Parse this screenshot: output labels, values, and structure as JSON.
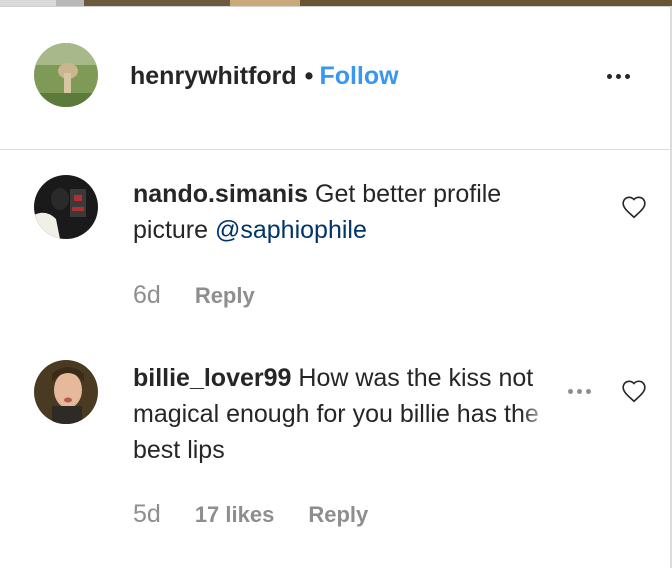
{
  "post_author": {
    "username": "henrywhitford",
    "separator": "•",
    "follow_label": "Follow"
  },
  "comments": [
    {
      "username": "nando.simanis",
      "text": "Get better profile picture",
      "mention": "@saphiophile",
      "time": "6d",
      "reply_label": "Reply"
    },
    {
      "username": "billie_lover99",
      "text": "How was the kiss not magical enough for you billie has the best lips",
      "time": "5d",
      "likes": "17 likes",
      "reply_label": "Reply"
    }
  ],
  "icons": {
    "more": "more-options-icon",
    "like": "heart-outline-icon"
  },
  "colors": {
    "link": "#3897f0",
    "mention": "#003569",
    "meta": "#8e8e8e",
    "text": "#262626"
  }
}
